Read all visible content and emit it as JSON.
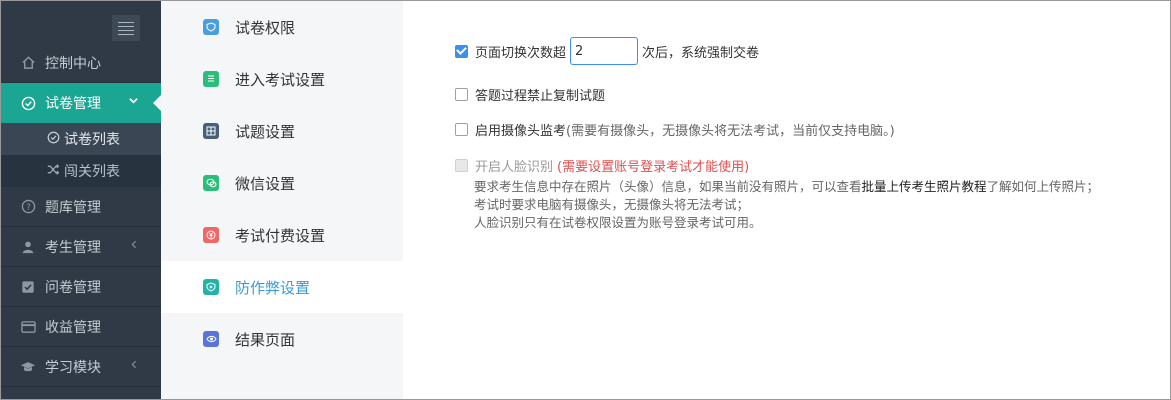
{
  "sidebar": {
    "items": [
      {
        "label": "控制中心",
        "icon": "home-icon"
      },
      {
        "label": "试卷管理",
        "icon": "check-circle-icon",
        "active": true
      },
      {
        "label": "题库管理",
        "icon": "question-circle-icon"
      },
      {
        "label": "考生管理",
        "icon": "user-icon"
      },
      {
        "label": "问卷管理",
        "icon": "checkbox-icon"
      },
      {
        "label": "收益管理",
        "icon": "card-icon"
      },
      {
        "label": "学习模块",
        "icon": "graduation-cap-icon"
      }
    ],
    "sub_items": [
      {
        "label": "试卷列表",
        "icon": "check-circle-icon"
      },
      {
        "label": "闯关列表",
        "icon": "shuffle-icon"
      }
    ]
  },
  "menu": {
    "items": [
      {
        "label": "试卷权限",
        "icon": "shield-icon",
        "color": "#4a9ee0"
      },
      {
        "label": "进入考试设置",
        "icon": "document-icon",
        "color": "#2dbd7a"
      },
      {
        "label": "试题设置",
        "icon": "grid-icon",
        "color": "#4a5e78"
      },
      {
        "label": "微信设置",
        "icon": "wechat-icon",
        "color": "#2dbd7a"
      },
      {
        "label": "考试付费设置",
        "icon": "yen-icon",
        "color": "#f06767"
      },
      {
        "label": "防作弊设置",
        "icon": "shield-plus-icon",
        "color": "#22b2a8"
      },
      {
        "label": "结果页面",
        "icon": "eye-icon",
        "color": "#5b74d8"
      }
    ]
  },
  "settings": {
    "page_switch": {
      "label": "页面切换次数超",
      "value": "2",
      "suffix": "次后，系统强制交卷"
    },
    "no_copy": {
      "label": "答题过程禁止复制试题"
    },
    "camera": {
      "label": "启用摄像头监考",
      "note": "(需要有摄像头，无摄像头将无法考试，当前仅支持电脑。)"
    },
    "face": {
      "label": "开启人脸识别",
      "warning": "(需要设置账号登录考试才能使用)"
    },
    "help": {
      "line1_pre": "要求考生信息中存在照片（头像）信息，如果当前没有照片，可以查看",
      "line1_link": "批量上传考生照片教程",
      "line1_post": "了解如何上传照片；",
      "line2": "考试时要求电脑有摄像头，无摄像头将无法考试；",
      "line3": "人脸识别只有在试卷权限设置为账号登录考试可用。"
    }
  },
  "colors": {
    "accent": "#1aa692",
    "sidebar": "#2f3a46",
    "link": "#3a9ad9",
    "warn": "#e05050"
  }
}
